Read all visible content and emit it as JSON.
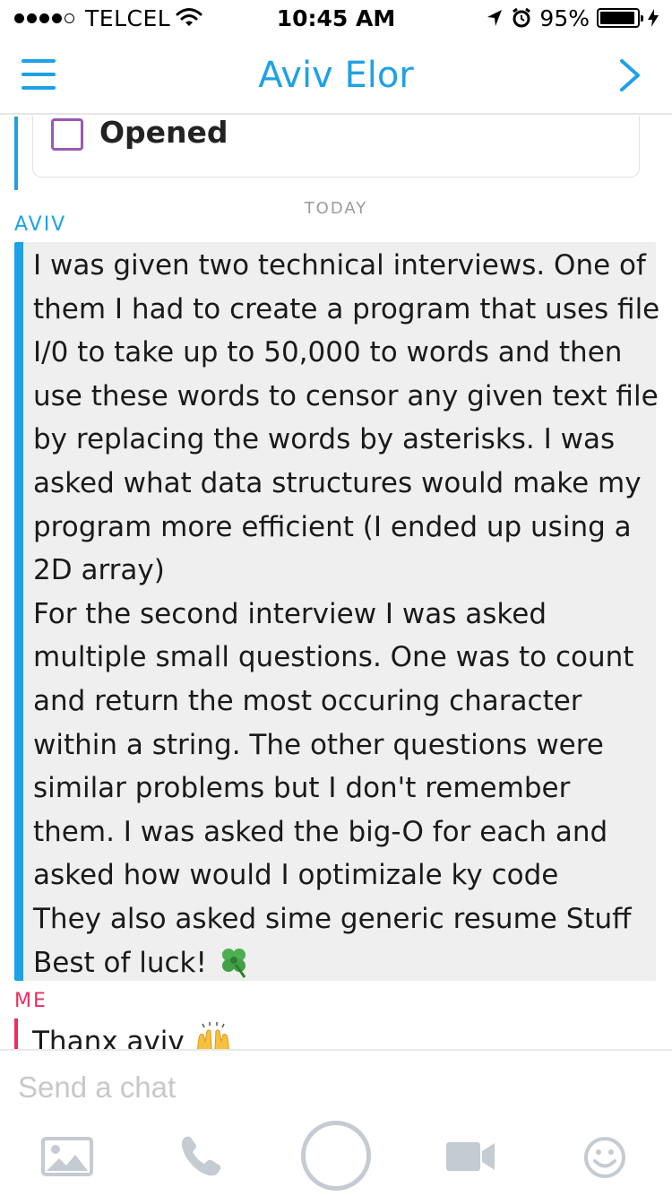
{
  "status_bar": {
    "carrier": "TELCEL",
    "time": "10:45 AM",
    "battery": "95%",
    "battery_level": 0.95
  },
  "header": {
    "title": "Aviv Elor",
    "menu_icon": "hamburger-menu-icon",
    "forward_icon": "chevron-right-icon"
  },
  "previous_message": {
    "status_label": "Opened"
  },
  "date_divider": "TODAY",
  "messages": [
    {
      "sender": "AVIV",
      "text": "I was given two technical interviews. One of them I had to create a program that uses file I/0 to take up to 50,000 to words and then use these words to censor any given text file by replacing the words by asterisks. I was asked what data structures would make my program more efficient (I ended up using a 2D array)\nFor the second interview I was asked multiple small questions. One was to count and return the most occuring character within a string. The other questions were similar problems but I don't remember them. I was asked the big-O for each and asked how would I optimizale ky code\nThey also asked sime generic resume Stuff\nBest of luck!",
      "emoji": "four-leaf-clover"
    },
    {
      "sender": "ME",
      "text": "Thanx aviv",
      "emoji": "raising-hands"
    }
  ],
  "composer": {
    "placeholder": "Send a chat"
  },
  "toolbar": {
    "icons": [
      "image-icon",
      "phone-icon",
      "capture-button",
      "video-camera-icon",
      "smiley-icon"
    ]
  },
  "colors": {
    "accent_blue": "#1ea1e6",
    "me_red": "#ee2e5d",
    "opened_purple": "#9a59b5",
    "bubble_gray": "#efefef",
    "icon_gray": "#c5cbd2"
  }
}
